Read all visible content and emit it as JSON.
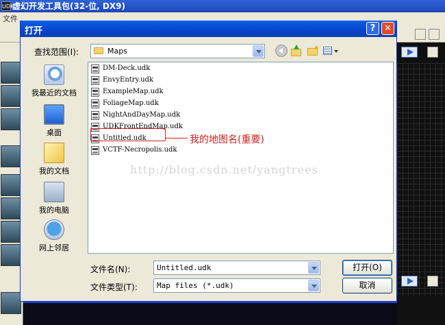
{
  "app": {
    "title": "虚幻开发工具包(32-位, DX9)",
    "logo_text": "UDK",
    "menu_fragment": "文件"
  },
  "dialog": {
    "title": "打开",
    "help_label": "?",
    "close_label": "✕",
    "look_in": {
      "label": "查找范围(I):",
      "value": "Maps"
    },
    "places": [
      {
        "label": "我最近的文档"
      },
      {
        "label": "桌面"
      },
      {
        "label": "我的文档"
      },
      {
        "label": "我的电脑"
      },
      {
        "label": "网上邻居"
      }
    ],
    "files": [
      "DM-Deck.udk",
      "EnvyEntry.udk",
      "ExampleMap.udk",
      "FoliageMap.udk",
      "NightAndDayMap.udk",
      "UDKFrontEndMap.udk",
      "Untitled.udk",
      "VCTF-Necropolis.udk"
    ],
    "file_name": {
      "label": "文件名(N):",
      "value": "Untitled.udk"
    },
    "file_type": {
      "label": "文件类型(T):",
      "value": "Map files (*.udk)"
    },
    "open_label": "打开(O)",
    "cancel_label": "取消"
  },
  "annotation": {
    "text": "我的地图名(重要)"
  },
  "watermark": "http://blog.csdn.net/yangtrees",
  "colors": {
    "annotation": "#d12020",
    "titlebar": "#0a5fe7"
  }
}
